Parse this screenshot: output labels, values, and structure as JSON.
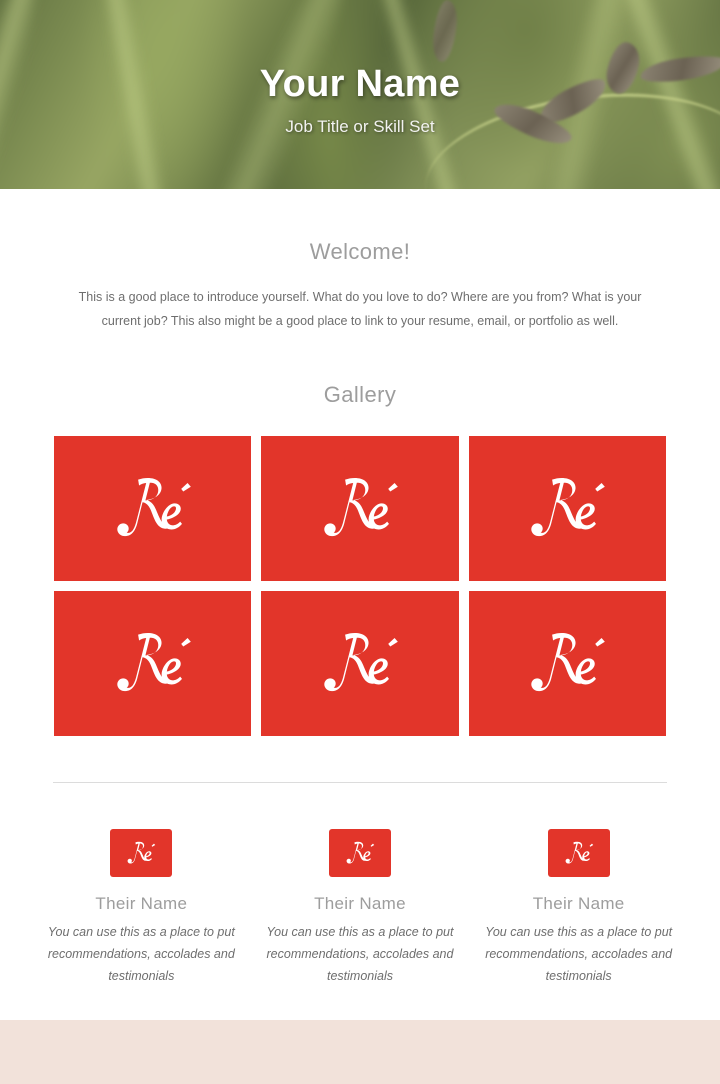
{
  "header": {
    "title": "Your Name",
    "subtitle": "Job Title or Skill Set",
    "background_image": "blurred-green-grass-photo"
  },
  "welcome": {
    "heading": "Welcome!",
    "body": "This is a good place to introduce yourself. What do you love to do? Where are you from? What is your current job? This also might be a good place to link to your resume, email, or portfolio as well."
  },
  "gallery": {
    "heading": "Gallery",
    "tile_color": "#e2352a",
    "logo_label": "Ré",
    "items": [
      {
        "alt": "Ré"
      },
      {
        "alt": "Ré"
      },
      {
        "alt": "Ré"
      },
      {
        "alt": "Ré"
      },
      {
        "alt": "Ré"
      },
      {
        "alt": "Ré"
      }
    ]
  },
  "testimonials": [
    {
      "name": "Their Name",
      "quote": "You can use this as a place to put recommendations, accolades and testimonials",
      "logo_label": "Ré"
    },
    {
      "name": "Their Name",
      "quote": "You can use this as a place to put recommendations, accolades and testimonials",
      "logo_label": "Ré"
    },
    {
      "name": "Their Name",
      "quote": "You can use this as a place to put recommendations, accolades and testimonials",
      "logo_label": "Ré"
    }
  ],
  "footer": {
    "background_color": "#f2e2da"
  },
  "theme": {
    "accent": "#e2352a",
    "heading_gray": "#9d9d9d",
    "body_gray": "#6e6e6e",
    "divider": "#dcdcdc"
  }
}
